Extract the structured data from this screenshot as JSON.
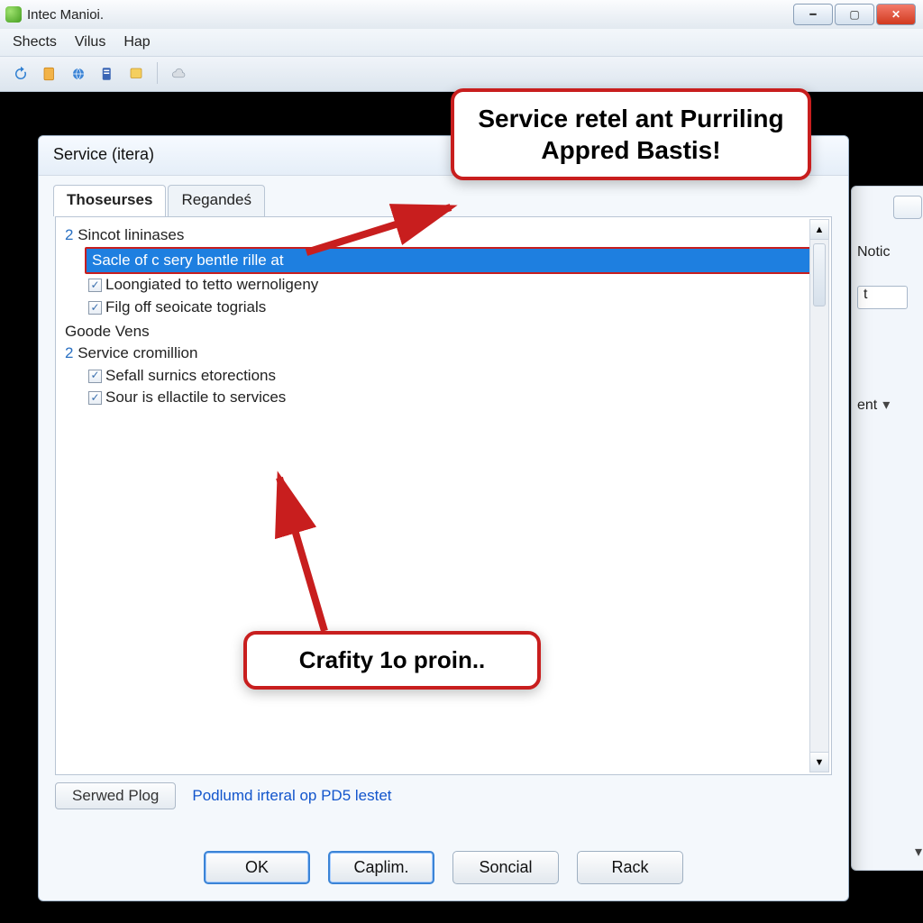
{
  "titlebar": {
    "app_title": "Intec Manioi."
  },
  "menubar": {
    "m1": "Shects",
    "m2": "Vilus",
    "m3": "Hap"
  },
  "toolbar_icons": [
    "refresh-icon",
    "page-icon",
    "globe-icon",
    "doc-icon",
    "note-icon",
    "cloud-icon"
  ],
  "rightpanel": {
    "label_notic": "Notic",
    "btn_t": "t",
    "label_ent": "ent"
  },
  "dialog": {
    "title": "Service (itera)",
    "tabs": {
      "t1": "Thoseurses",
      "t2": "Regandeś"
    },
    "tree": {
      "g1_num": "2",
      "g1_label": "Sincot lininases",
      "g1_sel": "Sacle of c sery bentle rille at",
      "g1_i2": "Loongiated to tetto wernoligeny",
      "g1_i3": "Filg off seoicate togrials",
      "g2_label": "Goode Vens",
      "g3_num": "2",
      "g3_label": "Service cromillion",
      "g3_i1": "Sefall surnics etorections",
      "g3_i2": "Sour is ellactile to services"
    },
    "served_button": "Serwed Plog",
    "link_text": "Podlumd irteral op PD5 lestet",
    "btn_ok": "OK",
    "btn_caplim": "Caplim.",
    "btn_soncial": "Soncial",
    "btn_rack": "Rack"
  },
  "callouts": {
    "top": "Service retel ant Purriling Appred Bastis!",
    "bottom": "Crafity 1o proin.."
  }
}
